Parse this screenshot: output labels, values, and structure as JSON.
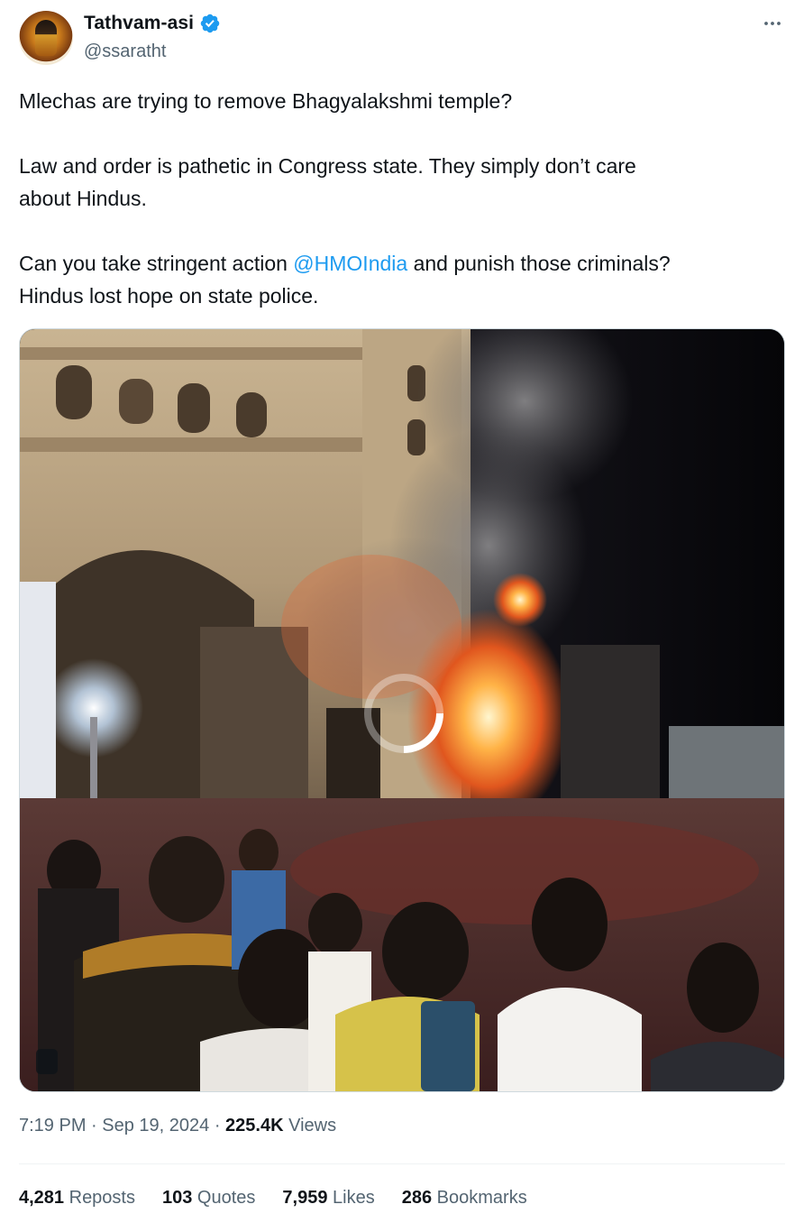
{
  "author": {
    "display_name": "Tathvam-asi",
    "handle": "@ssaratht",
    "verified": true,
    "avatar_icon": "deity-portrait-avatar"
  },
  "menu": {
    "more_icon": "more-horizontal-icon"
  },
  "text": {
    "line1": "Mlechas are trying to remove Bhagyalakshmi temple?",
    "line2a": "Law and order is pathetic in Congress state. They simply don’t care",
    "line2b": "about Hindus.",
    "line3_before": "Can you take stringent action ",
    "mention": "@HMOIndia",
    "line3_after": " and punish those criminals?",
    "line4": "Hindus lost hope on state police."
  },
  "media": {
    "type": "video",
    "state": "loading",
    "spinner_icon": "loading-spinner-icon"
  },
  "meta": {
    "time": "7:19 PM",
    "separator": " · ",
    "date": "Sep 19, 2024",
    "views_count": "225.4K",
    "views_label": " Views"
  },
  "stats": {
    "reposts_count": "4,281",
    "reposts_label": " Reposts",
    "quotes_count": "103",
    "quotes_label": " Quotes",
    "likes_count": "7,959",
    "likes_label": " Likes",
    "bookmarks_count": "286",
    "bookmarks_label": " Bookmarks"
  },
  "colors": {
    "accent": "#1d9bf0",
    "text_primary": "#0f1419",
    "text_secondary": "#536471"
  }
}
